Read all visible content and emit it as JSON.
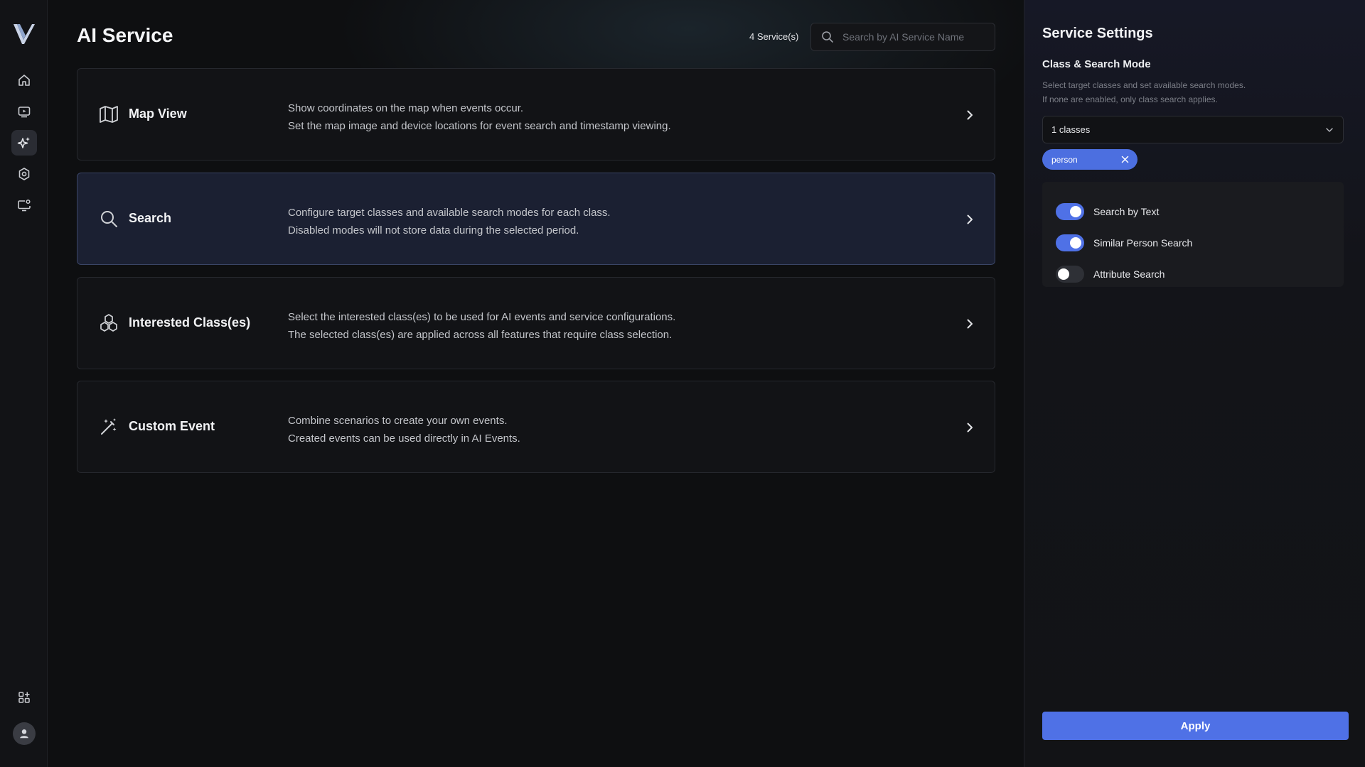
{
  "nav": {
    "logo_icon": "v-logo-icon",
    "items": [
      {
        "icon": "home-icon",
        "active": false
      },
      {
        "icon": "playback-icon",
        "active": false
      },
      {
        "icon": "ai-sparkle-icon",
        "active": true
      },
      {
        "icon": "settings-icon",
        "active": false
      },
      {
        "icon": "monitor-settings-icon",
        "active": false
      }
    ],
    "bottom": [
      {
        "icon": "apps-add-icon"
      },
      {
        "icon": "user-avatar-icon"
      }
    ]
  },
  "header": {
    "title": "AI Service",
    "count_label": "4 Service(s)",
    "search_placeholder": "Search by AI Service Name",
    "search_value": ""
  },
  "services": [
    {
      "icon": "map-icon",
      "title": "Map View",
      "desc_line1": "Show coordinates on the map when events occur.",
      "desc_line2": "Set the map image and device locations for event search and timestamp viewing.",
      "selected": false
    },
    {
      "icon": "search-icon",
      "title": "Search",
      "desc_line1": "Configure target classes and available search modes for each class.",
      "desc_line2": "Disabled modes will not store data during the selected period.",
      "selected": true
    },
    {
      "icon": "cubes-icon",
      "title": "Interested Class(es)",
      "desc_line1": "Select the interested class(es) to be used for AI events and service configurations.",
      "desc_line2": "The selected class(es) are applied across all features that require class selection.",
      "selected": false
    },
    {
      "icon": "magic-wand-icon",
      "title": "Custom Event",
      "desc_line1": "Combine scenarios to create your own events.",
      "desc_line2": "Created events can be used directly in AI Events.",
      "selected": false
    }
  ],
  "panel": {
    "title": "Service Settings",
    "subtitle": "Class & Search Mode",
    "hint_line1": "Select target classes and set available search modes.",
    "hint_line2": "If none are enabled, only class search applies.",
    "dropdown_value": "1 classes",
    "chip_label": "person",
    "modes": [
      {
        "label": "Search by Text",
        "enabled": true
      },
      {
        "label": "Similar Person Search",
        "enabled": true
      },
      {
        "label": "Attribute Search",
        "enabled": false
      }
    ],
    "apply_label": "Apply"
  },
  "colors": {
    "accent": "#4f71e6",
    "chip": "#4c6fe0",
    "selected_card": "#1b2032",
    "background": "#0e0f11"
  }
}
